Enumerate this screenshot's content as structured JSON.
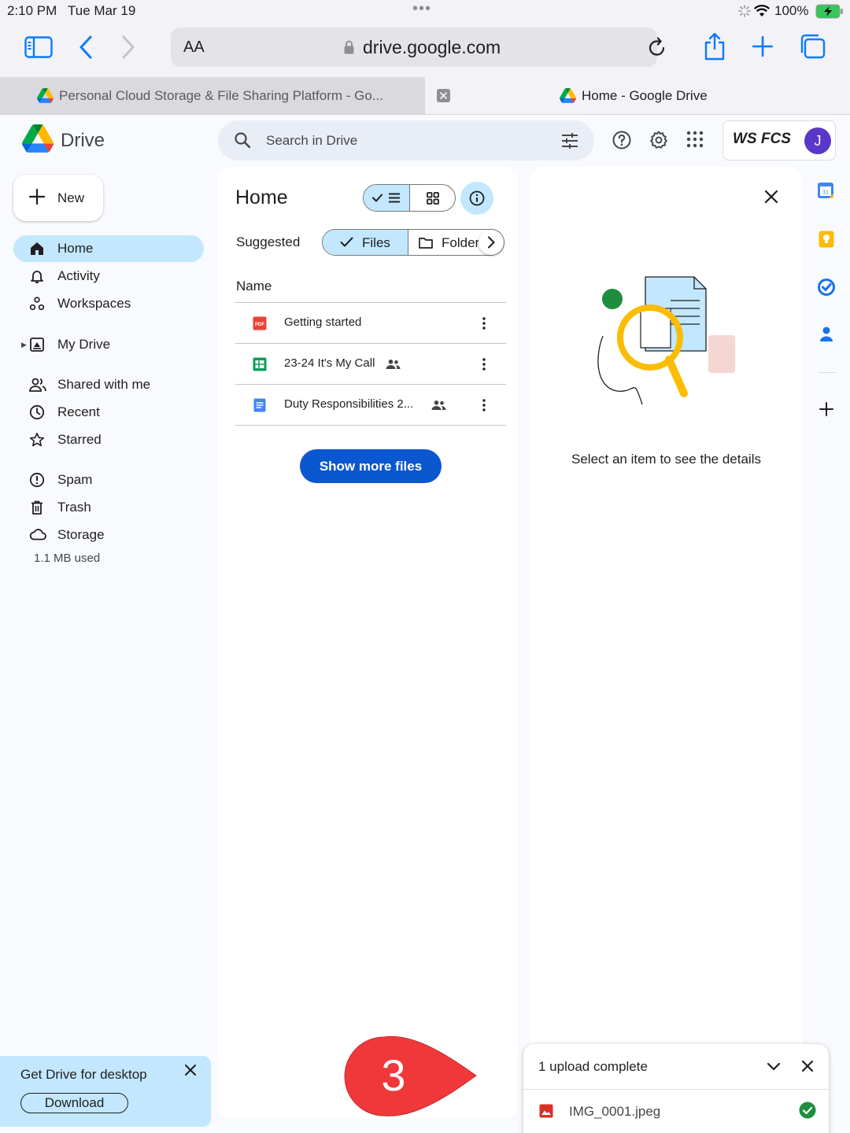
{
  "status_bar": {
    "time": "2:10 PM",
    "date": "Tue Mar 19",
    "battery_pct": "100%"
  },
  "browser": {
    "text_size_label": "AA",
    "url": "drive.google.com",
    "tabs": [
      {
        "label": "Personal Cloud Storage & File Sharing Platform - Go..."
      },
      {
        "label": "Home - Google Drive"
      }
    ]
  },
  "header": {
    "app_name": "Drive",
    "search_placeholder": "Search in Drive",
    "org_logo_text": "WS FCS",
    "avatar_initial": "J"
  },
  "sidebar": {
    "new_label": "New",
    "items": [
      {
        "label": "Home"
      },
      {
        "label": "Activity"
      },
      {
        "label": "Workspaces"
      },
      {
        "label": "My Drive"
      },
      {
        "label": "Shared with me"
      },
      {
        "label": "Recent"
      },
      {
        "label": "Starred"
      },
      {
        "label": "Spam"
      },
      {
        "label": "Trash"
      },
      {
        "label": "Storage"
      }
    ],
    "storage_used": "1.1 MB used"
  },
  "main": {
    "title": "Home",
    "suggested_label": "Suggested",
    "chips": {
      "files": "Files",
      "folders": "Folders"
    },
    "column_name": "Name",
    "files": [
      {
        "name": "Getting started",
        "type": "pdf",
        "shared": false
      },
      {
        "name": "23-24 It's My Call",
        "type": "sheets",
        "shared": true
      },
      {
        "name": "Duty Responsibilities 2...",
        "type": "docs",
        "shared": true
      }
    ],
    "show_more_label": "Show more files"
  },
  "details": {
    "empty_text": "Select an item to see the details"
  },
  "promo": {
    "title": "Get Drive for desktop",
    "download_label": "Download"
  },
  "upload": {
    "status": "1 upload complete",
    "file_name": "IMG_0001.jpeg"
  },
  "callout": {
    "number": "3"
  },
  "colors": {
    "accent": "#0b57d0",
    "selected_bg": "#c2e7ff",
    "callout_red": "#f0383b",
    "success_green": "#1e8e3e"
  }
}
